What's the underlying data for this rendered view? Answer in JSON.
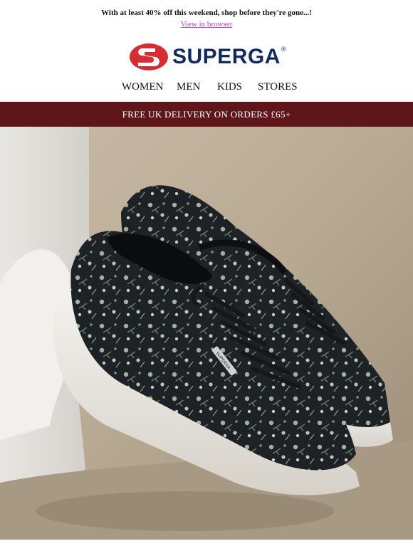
{
  "preheader": {
    "promo_text": "With at least 40% off this weekend, shop before they're gone...!",
    "view_in_browser": "View in browser"
  },
  "brand": {
    "name": "SUPERGA",
    "registered": "®",
    "colors": {
      "primary": "#132a5e",
      "accent": "#d42e34",
      "banner": "#5e161b"
    }
  },
  "nav": {
    "items": [
      {
        "label": "WOMEN"
      },
      {
        "label": "MEN"
      },
      {
        "label": "KIDS"
      },
      {
        "label": "STORES"
      }
    ]
  },
  "delivery_banner": {
    "text": "FREE UK DELIVERY ON ORDERS £65+"
  },
  "hero": {
    "subject": "floral platform sneakers",
    "sneaker_label": "SUPERGA"
  }
}
